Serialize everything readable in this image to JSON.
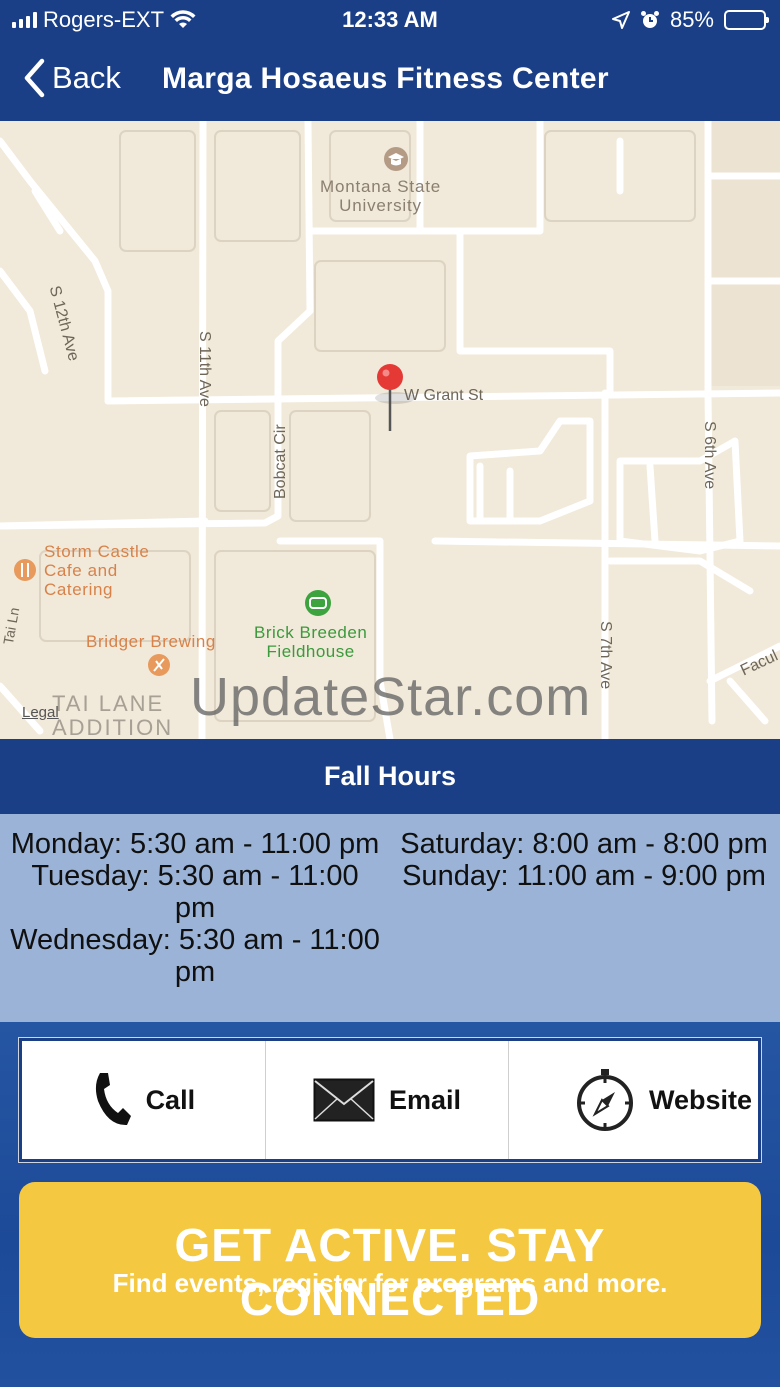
{
  "status_bar": {
    "carrier": "Rogers-EXT",
    "time": "12:33 AM",
    "battery": "85%",
    "battery_level": 0.85
  },
  "nav": {
    "back_label": "Back",
    "title": "Marga Hosaeus Fitness Center"
  },
  "map": {
    "labels": {
      "university": "Montana State\nUniversity",
      "w_grant_st": "W Grant St",
      "s_12th_ave": "S 12th Ave",
      "s_11th_ave": "S 11th Ave",
      "bobcat_cir": "Bobcat Cir",
      "s_6th_ave": "S 6th Ave",
      "s_7th_ave": "S 7th Ave",
      "storm_castle": "Storm Castle\nCafe and\nCatering",
      "bridger_brewing": "Bridger Brewing",
      "brick_breeden": "Brick Breeden\nFieldhouse",
      "tai_ln": "Tai Ln",
      "tai_lane_addition": "TAI LANE\nADDITION",
      "faculty": "Facul",
      "legal": "Legal"
    },
    "watermark": "UpdateStar.com"
  },
  "hours": {
    "title": "Fall Hours",
    "left": [
      "Monday: 5:30 am - 11:00 pm",
      "Tuesday: 5:30 am - 11:00 pm",
      "Wednesday: 5:30 am - 11:00 pm"
    ],
    "right": [
      "Saturday: 8:00 am - 8:00 pm",
      "Sunday: 11:00 am - 9:00 pm"
    ]
  },
  "actions": {
    "call": "Call",
    "email": "Email",
    "website": "Website"
  },
  "banner": {
    "headline": "GET ACTIVE.  STAY CONNECTED",
    "subline": "Find events, register for programs and more."
  },
  "colors": {
    "nav_blue": "#1b3f86",
    "hours_bg": "#9ab3d6",
    "banner_yellow": "#f5c842",
    "pin_red": "#e53935"
  }
}
